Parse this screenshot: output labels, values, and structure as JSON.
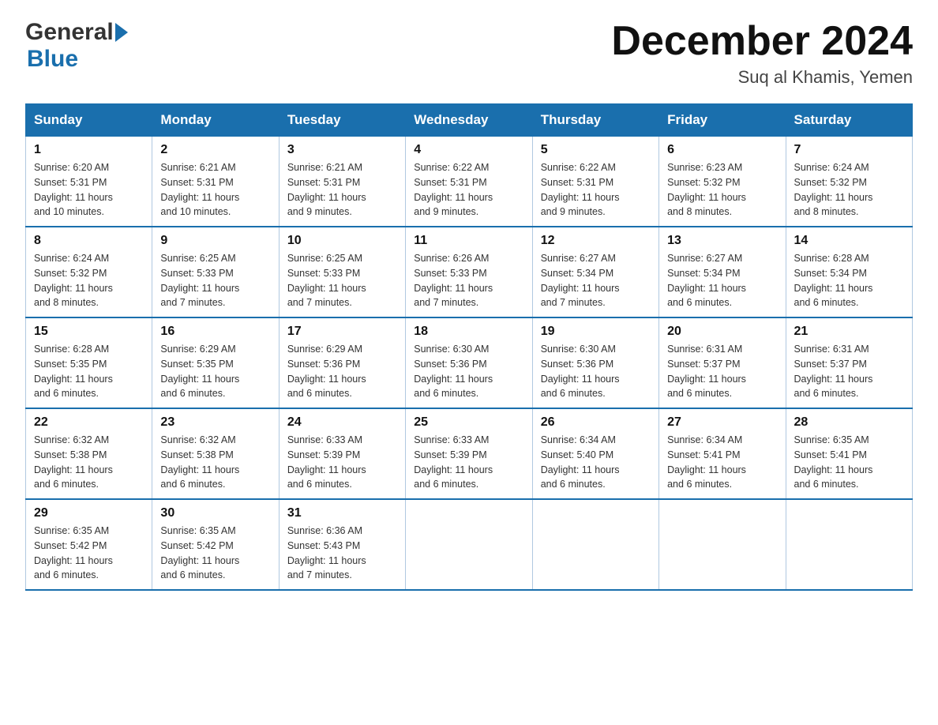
{
  "header": {
    "logo_general": "General",
    "logo_blue": "Blue",
    "main_title": "December 2024",
    "subtitle": "Suq al Khamis, Yemen"
  },
  "days_of_week": [
    "Sunday",
    "Monday",
    "Tuesday",
    "Wednesday",
    "Thursday",
    "Friday",
    "Saturday"
  ],
  "weeks": [
    [
      {
        "day": "1",
        "sunrise": "6:20 AM",
        "sunset": "5:31 PM",
        "daylight": "11 hours and 10 minutes."
      },
      {
        "day": "2",
        "sunrise": "6:21 AM",
        "sunset": "5:31 PM",
        "daylight": "11 hours and 10 minutes."
      },
      {
        "day": "3",
        "sunrise": "6:21 AM",
        "sunset": "5:31 PM",
        "daylight": "11 hours and 9 minutes."
      },
      {
        "day": "4",
        "sunrise": "6:22 AM",
        "sunset": "5:31 PM",
        "daylight": "11 hours and 9 minutes."
      },
      {
        "day": "5",
        "sunrise": "6:22 AM",
        "sunset": "5:31 PM",
        "daylight": "11 hours and 9 minutes."
      },
      {
        "day": "6",
        "sunrise": "6:23 AM",
        "sunset": "5:32 PM",
        "daylight": "11 hours and 8 minutes."
      },
      {
        "day": "7",
        "sunrise": "6:24 AM",
        "sunset": "5:32 PM",
        "daylight": "11 hours and 8 minutes."
      }
    ],
    [
      {
        "day": "8",
        "sunrise": "6:24 AM",
        "sunset": "5:32 PM",
        "daylight": "11 hours and 8 minutes."
      },
      {
        "day": "9",
        "sunrise": "6:25 AM",
        "sunset": "5:33 PM",
        "daylight": "11 hours and 7 minutes."
      },
      {
        "day": "10",
        "sunrise": "6:25 AM",
        "sunset": "5:33 PM",
        "daylight": "11 hours and 7 minutes."
      },
      {
        "day": "11",
        "sunrise": "6:26 AM",
        "sunset": "5:33 PM",
        "daylight": "11 hours and 7 minutes."
      },
      {
        "day": "12",
        "sunrise": "6:27 AM",
        "sunset": "5:34 PM",
        "daylight": "11 hours and 7 minutes."
      },
      {
        "day": "13",
        "sunrise": "6:27 AM",
        "sunset": "5:34 PM",
        "daylight": "11 hours and 6 minutes."
      },
      {
        "day": "14",
        "sunrise": "6:28 AM",
        "sunset": "5:34 PM",
        "daylight": "11 hours and 6 minutes."
      }
    ],
    [
      {
        "day": "15",
        "sunrise": "6:28 AM",
        "sunset": "5:35 PM",
        "daylight": "11 hours and 6 minutes."
      },
      {
        "day": "16",
        "sunrise": "6:29 AM",
        "sunset": "5:35 PM",
        "daylight": "11 hours and 6 minutes."
      },
      {
        "day": "17",
        "sunrise": "6:29 AM",
        "sunset": "5:36 PM",
        "daylight": "11 hours and 6 minutes."
      },
      {
        "day": "18",
        "sunrise": "6:30 AM",
        "sunset": "5:36 PM",
        "daylight": "11 hours and 6 minutes."
      },
      {
        "day": "19",
        "sunrise": "6:30 AM",
        "sunset": "5:36 PM",
        "daylight": "11 hours and 6 minutes."
      },
      {
        "day": "20",
        "sunrise": "6:31 AM",
        "sunset": "5:37 PM",
        "daylight": "11 hours and 6 minutes."
      },
      {
        "day": "21",
        "sunrise": "6:31 AM",
        "sunset": "5:37 PM",
        "daylight": "11 hours and 6 minutes."
      }
    ],
    [
      {
        "day": "22",
        "sunrise": "6:32 AM",
        "sunset": "5:38 PM",
        "daylight": "11 hours and 6 minutes."
      },
      {
        "day": "23",
        "sunrise": "6:32 AM",
        "sunset": "5:38 PM",
        "daylight": "11 hours and 6 minutes."
      },
      {
        "day": "24",
        "sunrise": "6:33 AM",
        "sunset": "5:39 PM",
        "daylight": "11 hours and 6 minutes."
      },
      {
        "day": "25",
        "sunrise": "6:33 AM",
        "sunset": "5:39 PM",
        "daylight": "11 hours and 6 minutes."
      },
      {
        "day": "26",
        "sunrise": "6:34 AM",
        "sunset": "5:40 PM",
        "daylight": "11 hours and 6 minutes."
      },
      {
        "day": "27",
        "sunrise": "6:34 AM",
        "sunset": "5:41 PM",
        "daylight": "11 hours and 6 minutes."
      },
      {
        "day": "28",
        "sunrise": "6:35 AM",
        "sunset": "5:41 PM",
        "daylight": "11 hours and 6 minutes."
      }
    ],
    [
      {
        "day": "29",
        "sunrise": "6:35 AM",
        "sunset": "5:42 PM",
        "daylight": "11 hours and 6 minutes."
      },
      {
        "day": "30",
        "sunrise": "6:35 AM",
        "sunset": "5:42 PM",
        "daylight": "11 hours and 6 minutes."
      },
      {
        "day": "31",
        "sunrise": "6:36 AM",
        "sunset": "5:43 PM",
        "daylight": "11 hours and 7 minutes."
      },
      null,
      null,
      null,
      null
    ]
  ],
  "sunrise_label": "Sunrise:",
  "sunset_label": "Sunset:",
  "daylight_label": "Daylight:"
}
